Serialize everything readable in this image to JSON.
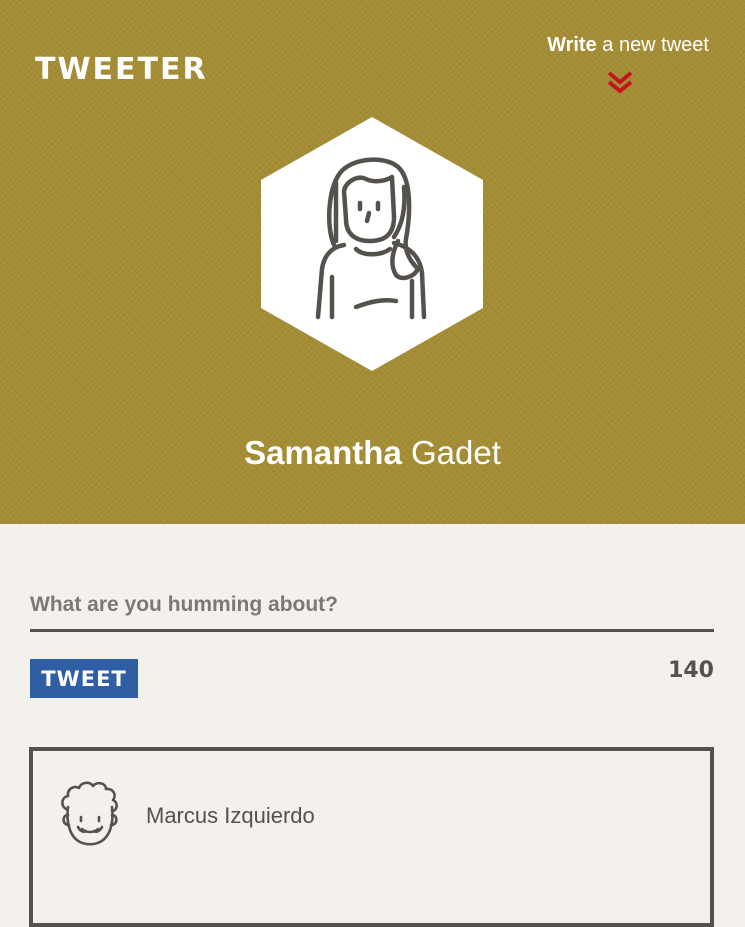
{
  "header": {
    "logo": "TWEETER",
    "write_link": {
      "bold": "Write",
      "rest": " a new tweet"
    }
  },
  "profile": {
    "first_name": "Samantha",
    "last_name": " Gadet"
  },
  "compose": {
    "placeholder": "What are you humming about?",
    "value": "",
    "button_label": "TWEET",
    "char_count": "140"
  },
  "feed": [
    {
      "author": "Marcus Izquierdo"
    }
  ],
  "colors": {
    "hero_bg": "#a58d35",
    "accent_red": "#c4151c",
    "tweet_button": "#2f5ea4",
    "text_dark": "#55524d",
    "page_bg": "#f4f1ec"
  },
  "icons": {
    "write_chevron": "double-chevron-down-icon",
    "profile_avatar": "woman-avatar-icon",
    "author_avatar": "curly-hair-man-avatar-icon"
  }
}
